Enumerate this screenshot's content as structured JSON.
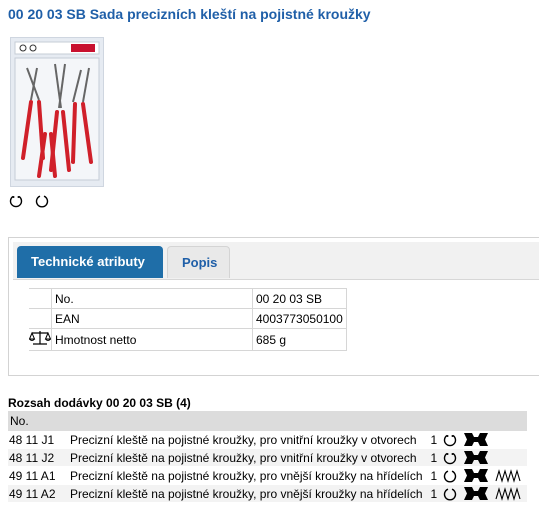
{
  "product": {
    "title": "00 20 03 SB Sada precizních kleští na pojistné kroužky"
  },
  "tabs": [
    {
      "label": "Technické atributy",
      "active": true
    },
    {
      "label": "Popis",
      "active": false
    }
  ],
  "attributes": [
    {
      "label": "No.",
      "value": "00 20 03 SB",
      "icon": ""
    },
    {
      "label": "EAN",
      "value": "4003773050100",
      "icon": ""
    },
    {
      "label": "Hmotnost netto",
      "value": "685 g",
      "icon": "scale-icon"
    }
  ],
  "scope": {
    "title": "Rozsah dodávky 00 20 03 SB (4)",
    "header": "No.",
    "rows": [
      {
        "code": "48 11 J1",
        "desc": "Precizní kleště na pojistné kroužky, pro vnitřní kroužky v otvorech",
        "qty": "1",
        "icons": [
          "internal-ring-icon",
          "plier-tip-icon"
        ]
      },
      {
        "code": "48 11 J2",
        "desc": "Precizní kleště na pojistné kroužky, pro vnitřní kroužky v otvorech",
        "qty": "1",
        "icons": [
          "internal-ring-icon",
          "plier-tip-icon"
        ]
      },
      {
        "code": "49 11 A1",
        "desc": "Precizní kleště na pojistné kroužky, pro vnější kroužky na hřídelích",
        "qty": "1",
        "icons": [
          "external-ring-icon",
          "plier-tip-icon",
          "shaft-icon"
        ]
      },
      {
        "code": "49 11 A2",
        "desc": "Precizní kleště na pojistné kroužky, pro vnější kroužky na hřídelích",
        "qty": "1",
        "icons": [
          "external-ring-icon",
          "plier-tip-icon",
          "shaft-icon"
        ]
      }
    ]
  },
  "colors": {
    "title": "#1f5fa8",
    "tab_active_bg": "#1f6ea8",
    "plier_handle": "#d0202a"
  }
}
